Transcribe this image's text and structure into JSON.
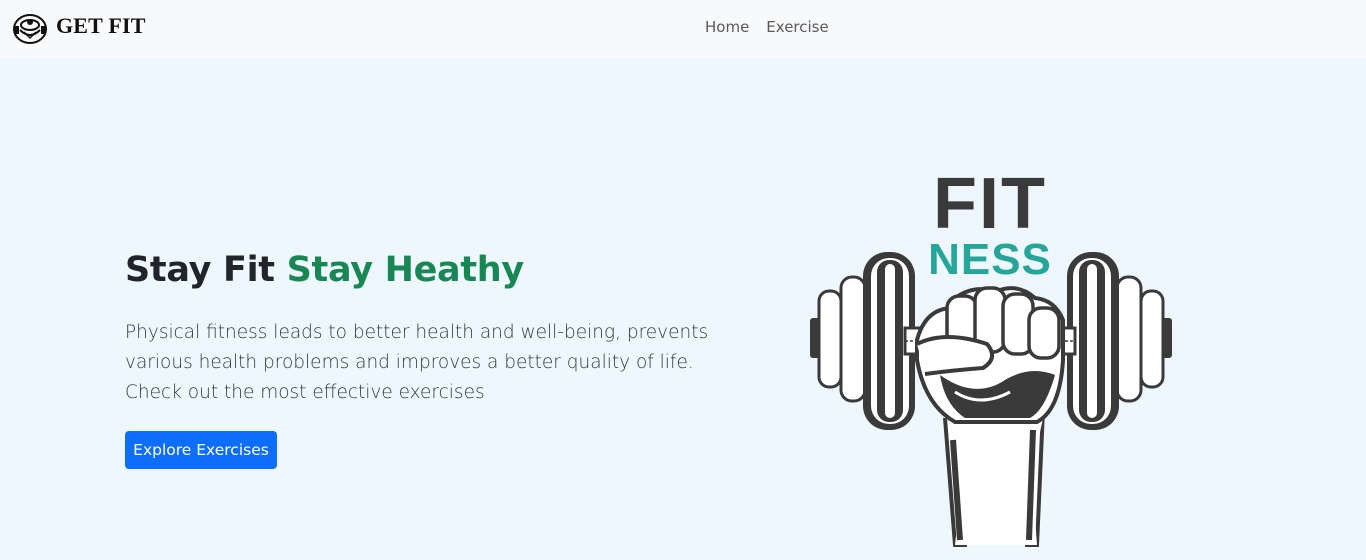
{
  "navbar": {
    "brand": {
      "icon": "barbell-body-icon",
      "text": "GET FIT"
    },
    "links": [
      {
        "label": "Home"
      },
      {
        "label": "Exercise"
      }
    ]
  },
  "hero": {
    "headline_plain": "Stay Fit",
    "headline_accent": "Stay Heathy",
    "description": "Physical fitness leads to better health and well-being, prevents various health problems and improves a better quality of life. Check out the most effective exercises",
    "cta_label": "Explore Exercises",
    "image": {
      "word_top": "FIT",
      "word_bottom": "NESS",
      "icon": "fist-dumbbell-icon"
    }
  },
  "colors": {
    "navbar_bg": "#f8f9fa",
    "hero_bg": "#eef7ff",
    "accent_green": "#198754",
    "button_blue": "#0d6efd",
    "logo_teal": "#26a69a",
    "logo_dark": "#3a3a3a"
  }
}
